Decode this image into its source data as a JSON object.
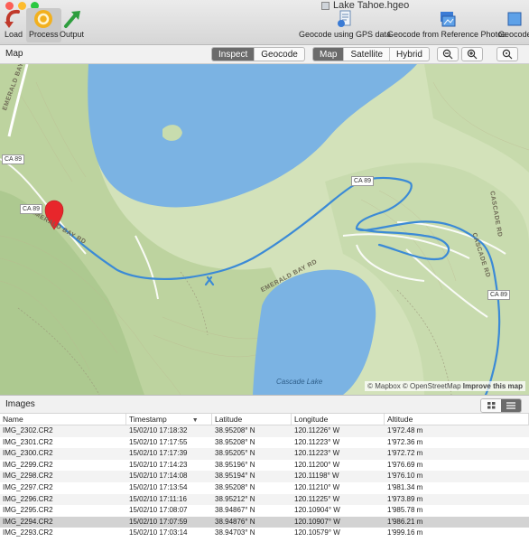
{
  "window": {
    "title": "Lake Tahoe.hgeo",
    "traffic_colors": [
      "#fc5f57",
      "#fdbc2e",
      "#2ac840"
    ]
  },
  "toolbar": {
    "load_label": "Load",
    "process_label": "Process",
    "output_label": "Output",
    "geocode_gps_label": "Geocode using GPS data",
    "geocode_ref_label": "Geocode from Reference Photos",
    "geocode_more_label": "Geocode"
  },
  "map_panel": {
    "title": "Map",
    "mode_tabs": [
      "Inspect",
      "Geocode"
    ],
    "selected_mode": "Inspect",
    "map_types": [
      "Map",
      "Satellite",
      "Hybrid"
    ],
    "selected_map_type": "Map",
    "zoom_out_icon": "zoom-out-icon",
    "zoom_in_icon": "zoom-in-icon",
    "zoom_fit_icon": "zoom-fit-icon"
  },
  "map": {
    "road_labels": [
      "EMERALD BAY RD",
      "EMERALD BAY RD",
      "EMERALD BAY RD",
      "CASCADE RD",
      "CASCADE RD"
    ],
    "shields": [
      "CA 89",
      "CA 89",
      "CA 89",
      "CA 89"
    ],
    "lake_label": "Cascade Lake",
    "attribution_prefix": "© Mapbox © OpenStreetMap ",
    "attribution_link": "Improve this map",
    "colors": {
      "land": "#d3e2ba",
      "water": "#7bb3e3",
      "track": "#3b8ad6",
      "marker": "#e8262b"
    }
  },
  "images_panel": {
    "title": "Images",
    "columns": [
      "Name",
      "Timestamp",
      "Latitude",
      "Longitude",
      "Altitude"
    ],
    "rows": [
      [
        "IMG_2302.CR2",
        "15/02/10 17:18:32",
        "38.95208° N",
        "120.11226° W",
        "1'972.48 m"
      ],
      [
        "IMG_2301.CR2",
        "15/02/10 17:17:55",
        "38.95208° N",
        "120.11223° W",
        "1'972.36 m"
      ],
      [
        "IMG_2300.CR2",
        "15/02/10 17:17:39",
        "38.95205° N",
        "120.11223° W",
        "1'972.72 m"
      ],
      [
        "IMG_2299.CR2",
        "15/02/10 17:14:23",
        "38.95196° N",
        "120.11200° W",
        "1'976.69 m"
      ],
      [
        "IMG_2298.CR2",
        "15/02/10 17:14:08",
        "38.95194° N",
        "120.11198° W",
        "1'976.10 m"
      ],
      [
        "IMG_2297.CR2",
        "15/02/10 17:13:54",
        "38.95208° N",
        "120.11210° W",
        "1'981.34 m"
      ],
      [
        "IMG_2296.CR2",
        "15/02/10 17:11:16",
        "38.95212° N",
        "120.11225° W",
        "1'973.89 m"
      ],
      [
        "IMG_2295.CR2",
        "15/02/10 17:08:07",
        "38.94867° N",
        "120.10904° W",
        "1'985.78 m"
      ],
      [
        "IMG_2294.CR2",
        "15/02/10 17:07:59",
        "38.94876° N",
        "120.10907° W",
        "1'986.21 m"
      ],
      [
        "IMG_2293.CR2",
        "15/02/10 17:03:14",
        "38.94703° N",
        "120.10579° W",
        "1'999.16 m"
      ]
    ],
    "selected_row": 8
  }
}
